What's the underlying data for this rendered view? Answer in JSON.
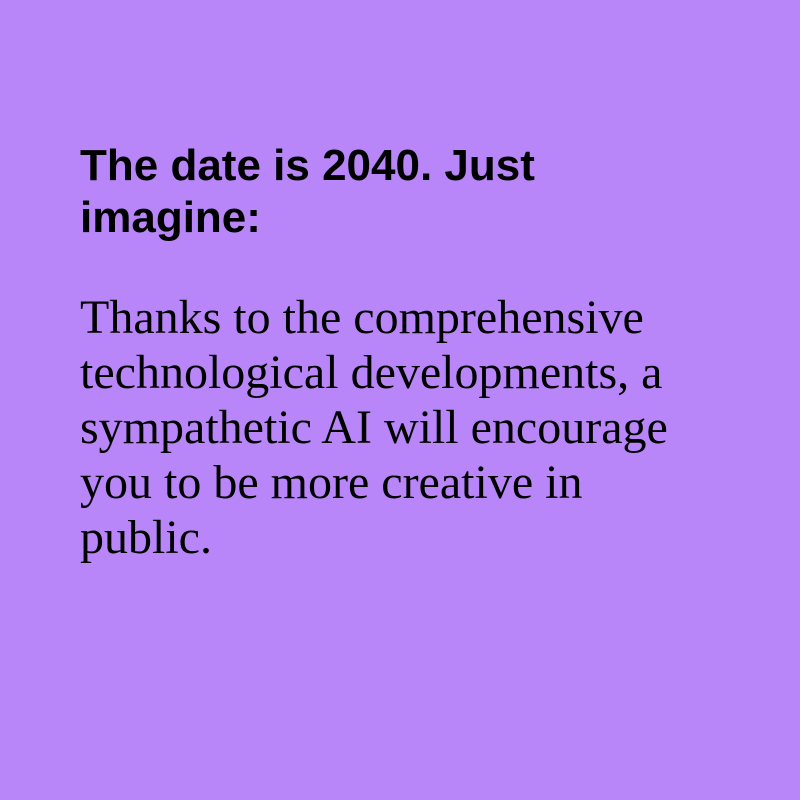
{
  "theme": {
    "background_color": "#b886f9",
    "text_color": "#000000"
  },
  "card": {
    "headline": "The date is 2040. Just imagine:",
    "body": "Thanks to the comprehensive technological developments, a sympathetic AI will encourage you to be more creative in public."
  }
}
